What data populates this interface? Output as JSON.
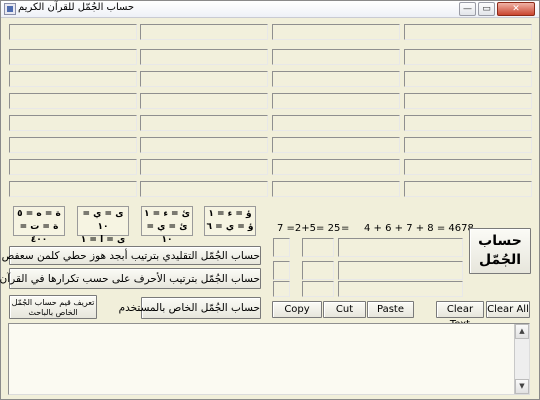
{
  "window": {
    "title": "حساب الجُمّل للقرآن الكريم",
    "min_glyph": "—",
    "max_glyph": "▭",
    "close_glyph": "✕"
  },
  "letter_values": [
    [
      "ؤ = ء = ١",
      "ؤ = ي = ٦"
    ],
    [
      "ئ = ء = ١",
      "ئ = ي = ١٠"
    ],
    [
      "ى = ي = ١٠",
      "ى = ا = ١"
    ],
    [
      "ة = ه = ٥",
      "ة = ت = ٤٠٠"
    ]
  ],
  "buttons": {
    "calc_big": "حساب الجُمّل",
    "abjad": "حساب الجُمّل التقليدي بترتيب أبجد هوز حطي كلمن سعفص",
    "by_frequency": "حساب الجُمّل  بترتيب الأحرف على حسب تكرارها في القرآن",
    "define_values": "تعريف قيم حساب الجُمّل الخاص بالباحث",
    "custom": "حساب الجُمّل  الخاص بالمستخدم",
    "copy": "Copy",
    "cut": "Cut",
    "paste": "Paste",
    "clear_text": "Clear Text",
    "clear_all": "Clear All"
  },
  "calc": {
    "digit_sum": "7 =2+5=  25",
    "equals": "=",
    "letter_sum": "4 + 6 + 7 + 8  =  4678"
  },
  "memo": {
    "scroll_up": "▲",
    "scroll_down": "▼"
  }
}
